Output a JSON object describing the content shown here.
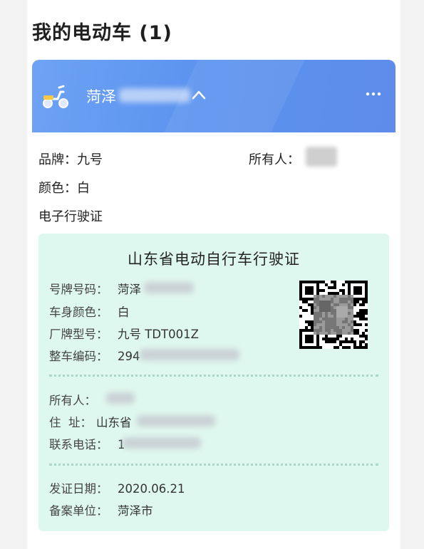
{
  "page": {
    "title": "我的电动车 (1)"
  },
  "vehicle_header": {
    "plate_prefix": "菏泽",
    "more_label": "..."
  },
  "info": {
    "brand": "品牌：九号",
    "color": "颜色：白",
    "owner_label": "所有人：",
    "section_label": "电子行驶证"
  },
  "license": {
    "title": "山东省电动自行车行驶证",
    "fields": [
      {
        "label": "号牌号码：",
        "value": "菏泽"
      },
      {
        "label": "车身颜色：",
        "value": "白"
      },
      {
        "label": "厂牌型号：",
        "value": "九号 TDT001Z"
      },
      {
        "label": "整车编码：",
        "value": "294"
      }
    ],
    "owner_fields": [
      {
        "label": "所有人：",
        "value": ""
      },
      {
        "label": "住  址：",
        "value": "山东省"
      },
      {
        "label": "联系电话：",
        "value": "1"
      }
    ],
    "issue_fields": [
      {
        "label": "发证日期：",
        "value": "2020.06.21"
      },
      {
        "label": "备案单位：",
        "value": "菏泽市"
      }
    ]
  },
  "colors": {
    "header_blue": "#5b93ef",
    "license_bg": "#dff8ef"
  }
}
